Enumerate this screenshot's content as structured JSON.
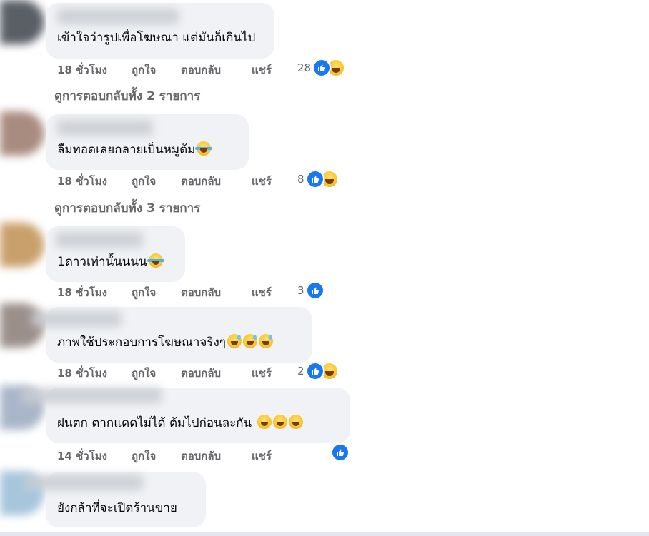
{
  "comments": [
    {
      "text": "เข้าใจว่ารูปเพื่อโฆษณา แต่มันก็เกินไป",
      "emojis": [],
      "time": "18 ชั่วโมง",
      "like": "ถูกใจ",
      "reply": "ตอบกลับ",
      "share": "แชร์",
      "reaction_count": "28",
      "reactions": [
        "like-icon",
        "haha-icon"
      ]
    },
    {
      "text": "ลืมทอดเลยกลายเป็นหมูต้ม",
      "emojis": [
        "crying-laughing-emoji"
      ],
      "time": "18 ชั่วโมง",
      "like": "ถูกใจ",
      "reply": "ตอบกลับ",
      "share": "แชร์",
      "reaction_count": "8",
      "reactions": [
        "like-icon",
        "haha-icon"
      ]
    },
    {
      "text": "1ดาวเท่านั้นนนน",
      "emojis": [
        "crying-laughing-emoji"
      ],
      "time": "18 ชั่วโมง",
      "like": "ถูกใจ",
      "reply": "ตอบกลับ",
      "share": "แชร์",
      "reaction_count": "3",
      "reactions": [
        "like-icon"
      ]
    },
    {
      "text": "ภาพใช้ประกอบการโฆษณาจริงๆ",
      "emojis": [
        "sweat-smile-emoji",
        "sweat-smile-emoji",
        "sweat-smile-emoji"
      ],
      "time": "18 ชั่วโมง",
      "like": "ถูกใจ",
      "reply": "ตอบกลับ",
      "share": "แชร์",
      "reaction_count": "2",
      "reactions": [
        "like-icon",
        "haha-icon"
      ]
    },
    {
      "text": "ฝนตก ตากแดดไม่ได้ ต้มไปก่อนละกัน",
      "emojis": [
        "grin-emoji",
        "grin-emoji",
        "grin-emoji"
      ],
      "time": "14 ชั่วโมง",
      "like": "ถูกใจ",
      "reply": "ตอบกลับ",
      "share": "แชร์",
      "reaction_count": "",
      "reactions": [
        "like-icon"
      ]
    },
    {
      "text": "ยังกล้าที่จะเปิดร้านขาย",
      "emojis": [],
      "time": "",
      "like": "",
      "reply": "",
      "share": "",
      "reaction_count": "",
      "reactions": []
    }
  ],
  "view_replies": [
    "ดูการตอบกลับทั้ง 2 รายการ",
    "ดูการตอบกลับทั้ง 3 รายการ"
  ],
  "colors": {
    "bubble": "#f0f2f5",
    "meta_text": "#65676b",
    "like_blue": "#1877f2",
    "emoji_yellow": "#f7c531"
  }
}
